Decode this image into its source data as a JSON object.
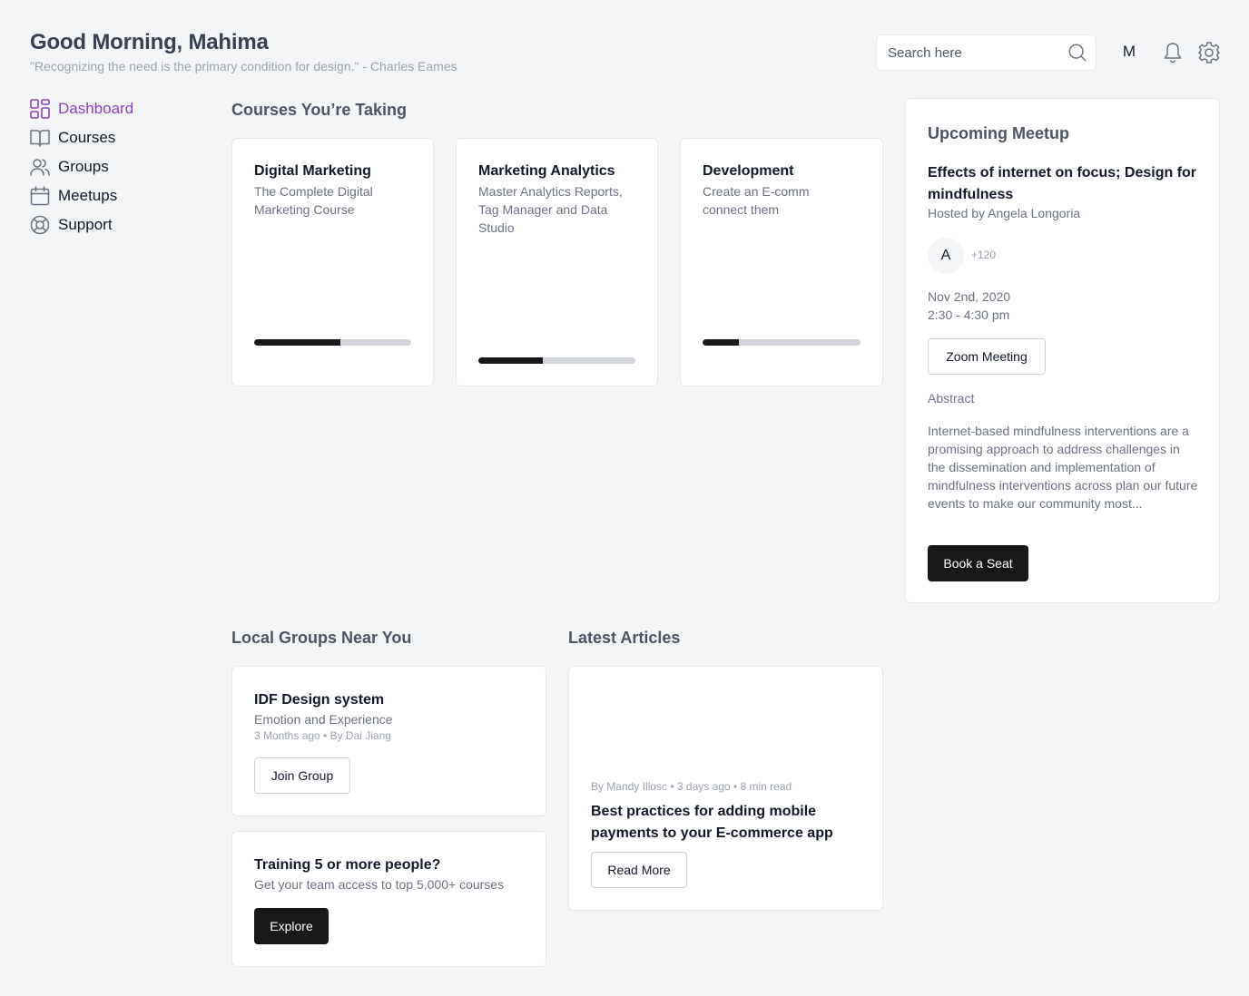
{
  "header": {
    "greeting": "Good Morning, Mahima",
    "quote": "\"Recognizing the need is the primary condition for design.\" - Charles Eames",
    "search_placeholder": "Search here",
    "avatar_initial": "M"
  },
  "sidebar": {
    "items": [
      {
        "label": "Dashboard",
        "icon": "dashboard-icon",
        "active": true
      },
      {
        "label": "Courses",
        "icon": "book-icon",
        "active": false
      },
      {
        "label": "Groups",
        "icon": "users-icon",
        "active": false
      },
      {
        "label": "Meetups",
        "icon": "calendar-icon",
        "active": false
      },
      {
        "label": "Support",
        "icon": "lifebuoy-icon",
        "active": false
      }
    ]
  },
  "courses": {
    "title": "Courses You’re Taking",
    "items": [
      {
        "title": "Digital Marketing",
        "subtitle": "The Complete Digital Marketing Course",
        "progress": 0.55
      },
      {
        "title": "Marketing Analytics",
        "subtitle": "Master Analytics Reports, Tag Manager and Data Studio",
        "progress": 0.41
      },
      {
        "title": "Development",
        "subtitle": "Create an E-comm connect them",
        "progress": 0.23
      }
    ]
  },
  "meetup": {
    "section_title": "Upcoming Meetup",
    "title": "Effects of internet on focus; Design for mindfulness",
    "host": "Hosted by Angela Longoria",
    "attendee_initial": "A",
    "attendee_more": "+120",
    "date": "Nov 2nd, 2020",
    "time": "2:30 - 4:30 pm",
    "zoom_label": "Zoom Meeting",
    "abstract_label": "Abstract",
    "abstract": "Internet-based mindfulness interventions are a promising approach to address challenges in the dissemination and implementation of mindfulness interventions across plan our future events to make our community most...",
    "book_label": "Book a Seat"
  },
  "groups": {
    "title": "Local Groups Near You",
    "group": {
      "name": "IDF Design system",
      "subtitle": "Emotion and Experience",
      "meta": "3 Months ago • By Dai Jiang",
      "join_label": "Join Group"
    },
    "training": {
      "title": "Training 5 or more people?",
      "subtitle": "Get your team access to top 5,000+ courses",
      "explore_label": "Explore"
    }
  },
  "articles": {
    "title": "Latest Articles",
    "item": {
      "meta": "By Mandy Illosc • 3 days ago • 8 min read",
      "title": "Best practices for adding mobile payments to your E-commerce app",
      "read_more_label": "Read More"
    }
  },
  "colors": {
    "accent": "#8b3fc4",
    "dark_button": "#18181b",
    "background": "#f3f4f6"
  }
}
